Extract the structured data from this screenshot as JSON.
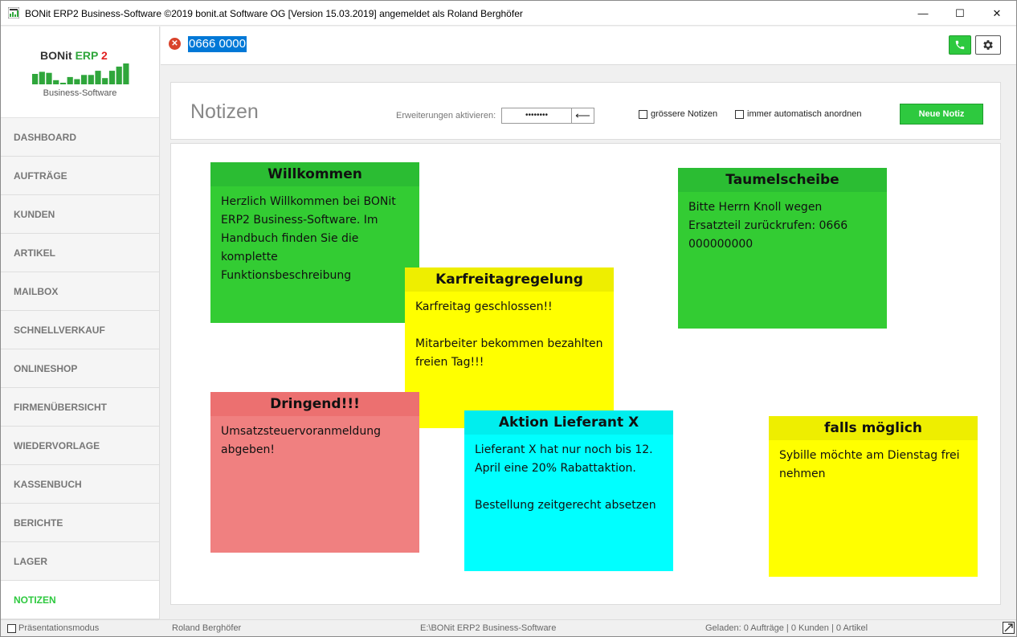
{
  "window": {
    "title": "BONit ERP2 Business-Software ©2019 bonit.at Software OG [Version 15.03.2019] angemeldet als Roland Berghöfer",
    "controls": {
      "minimize": "—",
      "maximize": "☐",
      "close": "✕"
    }
  },
  "logo": {
    "name": "BONit",
    "erp": "ERP",
    "num": "2",
    "subtitle": "Business-Software",
    "bar_levels": [
      0.5,
      0.6,
      0.55,
      0.2,
      0.05,
      0.35,
      0.25,
      0.45,
      0.45,
      0.65,
      0.3,
      0.65,
      0.85,
      1.0
    ]
  },
  "sidebar": {
    "items": [
      {
        "label": "DASHBOARD"
      },
      {
        "label": "AUFTRÄGE"
      },
      {
        "label": "KUNDEN"
      },
      {
        "label": "ARTIKEL"
      },
      {
        "label": "MAILBOX"
      },
      {
        "label": "SCHNELLVERKAUF"
      },
      {
        "label": "ONLINESHOP"
      },
      {
        "label": "FIRMENÜBERSICHT"
      },
      {
        "label": "WIEDERVORLAGE"
      },
      {
        "label": "KASSENBUCH"
      },
      {
        "label": "BERICHTE"
      },
      {
        "label": "LAGER"
      },
      {
        "label": "NOTIZEN",
        "active": true
      }
    ]
  },
  "topbar": {
    "phone_value": "0666 0000",
    "error_icon": "close-circle-icon",
    "call_icon": "phone-icon",
    "settings_icon": "gear-icon"
  },
  "page": {
    "title": "Notizen",
    "ext_label": "Erweiterungen aktivieren:",
    "ext_value": "••••••••",
    "ext_button": "⟵",
    "chk_bigger": "grössere Notizen",
    "chk_auto": "immer automatisch anordnen",
    "new_note": "Neue Notiz"
  },
  "notes": [
    {
      "title": "Willkommen",
      "color": "green",
      "body": "Herzlich Willkommen bei BONit ERP2 Business-Software. Im Handbuch finden Sie die komplette Funktionsbeschreibung"
    },
    {
      "title": "Taumelscheibe",
      "color": "green",
      "body": "Bitte Herrn Knoll wegen Ersatzteil zurückrufen: 0666 000000000"
    },
    {
      "title": "Karfreitagregelung",
      "color": "yellow",
      "body": "Karfreitag geschlossen!!\n\nMitarbeiter bekommen bezahlten freien Tag!!!"
    },
    {
      "title": "Dringend!!!",
      "color": "red",
      "body": "Umsatzsteuervoranmeldung abgeben!"
    },
    {
      "title": "Aktion Lieferant X",
      "color": "cyan",
      "body": "Lieferant X hat nur noch bis 12. April eine 20% Rabattaktion.\n\nBestellung zeitgerecht absetzen"
    },
    {
      "title": "falls möglich",
      "color": "yellow",
      "body": "Sybille möchte am Dienstag frei nehmen"
    }
  ],
  "colors": {
    "accent_green": "#2ec93f",
    "note_green": "#33cc33",
    "note_yellow": "#ffff00",
    "note_red": "#f08080",
    "note_cyan": "#00ffff"
  },
  "status": {
    "presentation": "Präsentationsmodus",
    "user": "Roland Berghöfer",
    "path": "E:\\BONit ERP2 Business-Software",
    "loaded": "Geladen: 0 Aufträge | 0 Kunden | 0 Artikel"
  }
}
